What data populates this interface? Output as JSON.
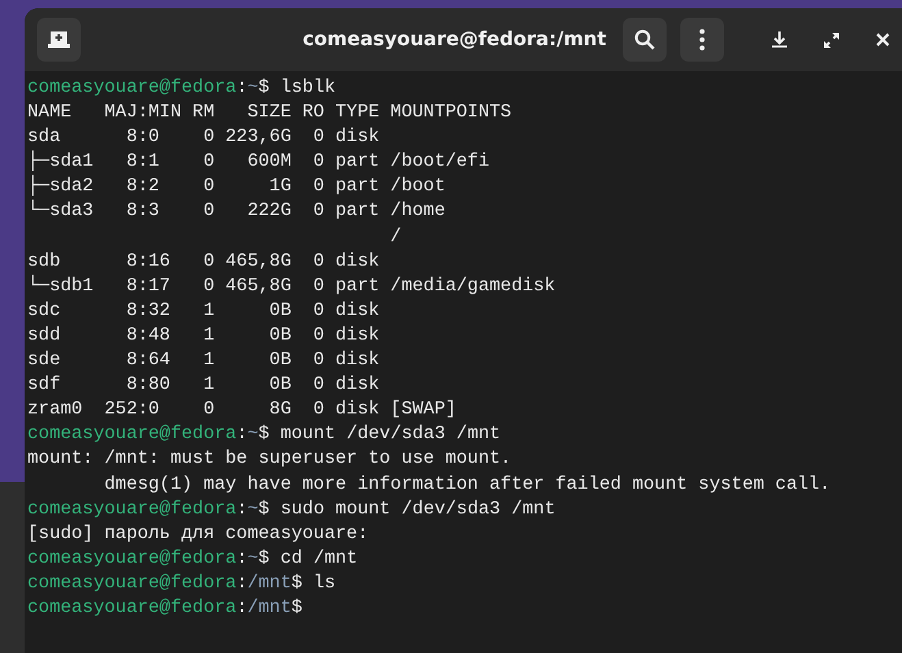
{
  "window": {
    "title": "comeasyouare@fedora:/mnt"
  },
  "lines": [
    {
      "kind": "prompt",
      "segments": [
        {
          "text": "comeasyouare@fedora",
          "color": "#33b27a"
        },
        {
          "text": ":",
          "color": "#e8e8e8"
        },
        {
          "text": "~",
          "color": "#8aa0b8"
        },
        {
          "text": "$ lsblk",
          "color": "#e8e8e8"
        }
      ]
    },
    {
      "kind": "output",
      "text": "NAME   MAJ:MIN RM   SIZE RO TYPE MOUNTPOINTS"
    },
    {
      "kind": "output",
      "text": "sda      8:0    0 223,6G  0 disk "
    },
    {
      "kind": "output",
      "text": "├─sda1   8:1    0   600M  0 part /boot/efi"
    },
    {
      "kind": "output",
      "text": "├─sda2   8:2    0     1G  0 part /boot"
    },
    {
      "kind": "output",
      "text": "└─sda3   8:3    0   222G  0 part /home"
    },
    {
      "kind": "output",
      "text": "                                 /"
    },
    {
      "kind": "output",
      "text": "sdb      8:16   0 465,8G  0 disk "
    },
    {
      "kind": "output",
      "text": "└─sdb1   8:17   0 465,8G  0 part /media/gamedisk"
    },
    {
      "kind": "output",
      "text": "sdc      8:32   1     0B  0 disk "
    },
    {
      "kind": "output",
      "text": "sdd      8:48   1     0B  0 disk "
    },
    {
      "kind": "output",
      "text": "sde      8:64   1     0B  0 disk "
    },
    {
      "kind": "output",
      "text": "sdf      8:80   1     0B  0 disk "
    },
    {
      "kind": "output",
      "text": "zram0  252:0    0     8G  0 disk [SWAP]"
    },
    {
      "kind": "prompt",
      "segments": [
        {
          "text": "comeasyouare@fedora",
          "color": "#33b27a"
        },
        {
          "text": ":",
          "color": "#e8e8e8"
        },
        {
          "text": "~",
          "color": "#8aa0b8"
        },
        {
          "text": "$ mount /dev/sda3 /mnt",
          "color": "#e8e8e8"
        }
      ]
    },
    {
      "kind": "output",
      "text": "mount: /mnt: must be superuser to use mount."
    },
    {
      "kind": "output",
      "text": "       dmesg(1) may have more information after failed mount system call."
    },
    {
      "kind": "prompt",
      "segments": [
        {
          "text": "comeasyouare@fedora",
          "color": "#33b27a"
        },
        {
          "text": ":",
          "color": "#e8e8e8"
        },
        {
          "text": "~",
          "color": "#8aa0b8"
        },
        {
          "text": "$ sudo mount /dev/sda3 /mnt",
          "color": "#e8e8e8"
        }
      ]
    },
    {
      "kind": "output",
      "text": "[sudo] пароль для comeasyouare: "
    },
    {
      "kind": "prompt",
      "segments": [
        {
          "text": "comeasyouare@fedora",
          "color": "#33b27a"
        },
        {
          "text": ":",
          "color": "#e8e8e8"
        },
        {
          "text": "~",
          "color": "#8aa0b8"
        },
        {
          "text": "$ cd /mnt",
          "color": "#e8e8e8"
        }
      ]
    },
    {
      "kind": "prompt",
      "segments": [
        {
          "text": "comeasyouare@fedora",
          "color": "#33b27a"
        },
        {
          "text": ":",
          "color": "#e8e8e8"
        },
        {
          "text": "/mnt",
          "color": "#8aa0b8"
        },
        {
          "text": "$ ls",
          "color": "#e8e8e8"
        }
      ]
    },
    {
      "kind": "prompt",
      "segments": [
        {
          "text": "comeasyouare@fedora",
          "color": "#33b27a"
        },
        {
          "text": ":",
          "color": "#e8e8e8"
        },
        {
          "text": "/mnt",
          "color": "#8aa0b8"
        },
        {
          "text": "$",
          "color": "#e8e8e8"
        }
      ]
    }
  ]
}
